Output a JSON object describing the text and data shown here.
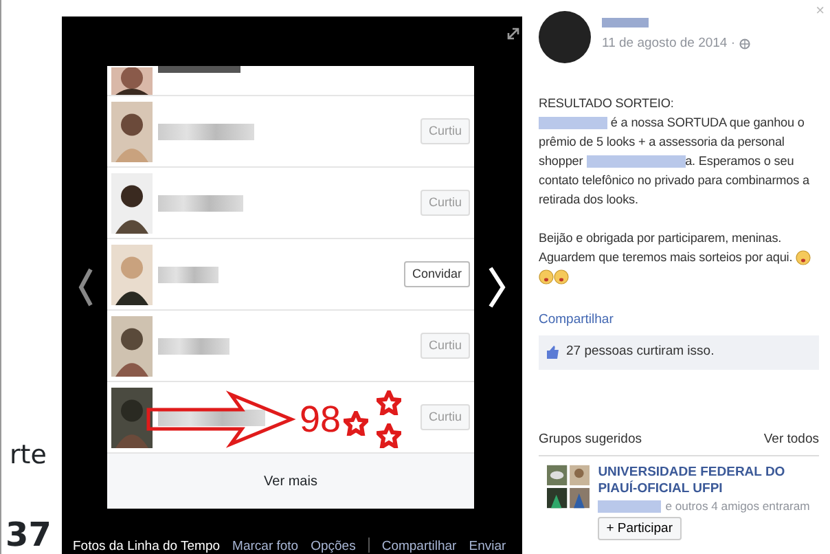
{
  "left_fragment": {
    "text": "rte",
    "number": "37"
  },
  "viewer": {
    "rows": [
      {
        "kind": "partial"
      },
      {
        "kind": "liked",
        "button": "Curtiu"
      },
      {
        "kind": "liked",
        "button": "Curtiu"
      },
      {
        "kind": "invite",
        "button": "Convidar"
      },
      {
        "kind": "liked",
        "button": "Curtiu"
      },
      {
        "kind": "liked",
        "button": "Curtiu",
        "annotation": "98"
      }
    ],
    "more_link": "Ver mais",
    "bottom_bar": [
      {
        "label": "Fotos da Linha do Tempo",
        "kind": "title",
        "divider_before": false
      },
      {
        "label": "Marcar foto",
        "kind": "action",
        "divider_before": false
      },
      {
        "label": "Opções",
        "kind": "action",
        "divider_before": false
      },
      {
        "label": "Compartilhar",
        "kind": "action",
        "divider_before": true
      },
      {
        "label": "Enviar",
        "kind": "action",
        "divider_before": false
      }
    ]
  },
  "post": {
    "close": "×",
    "date": "11 de agosto de 2014 ·",
    "paragraphs": [
      [
        {
          "kind": "text",
          "text": "RESULTADO SORTEIO:"
        },
        {
          "kind": "break"
        },
        {
          "kind": "redacted"
        },
        {
          "kind": "text",
          "text": " é a nossa SORTUDA que ganhou o prêmio de 5 looks + a assessoria da personal shopper "
        },
        {
          "kind": "redacted"
        },
        {
          "kind": "text",
          "text": "a. Esperamos o seu contato telefônico no privado para combinarmos a retirada dos looks."
        }
      ],
      [
        {
          "kind": "text",
          "text": "Beijão e obrigada por participarem, meninas. Aguardem que teremos mais sorteios por aqui. "
        },
        {
          "kind": "emoji"
        },
        {
          "kind": "break"
        },
        {
          "kind": "emoji"
        },
        {
          "kind": "emoji"
        }
      ]
    ],
    "share": "Compartilhar",
    "likes": {
      "link": "27 pessoas",
      "text": "curtiram isso."
    }
  },
  "groups": {
    "title": "Grupos sugeridos",
    "see_all": "Ver todos",
    "items": [
      {
        "name": "UNIVERSIDADE FEDERAL DO PIAUÍ-OFICIAL UFPI",
        "friends_link": "e outros 4 amigos",
        "joined": "entraram",
        "button": "+ Participar"
      }
    ]
  }
}
